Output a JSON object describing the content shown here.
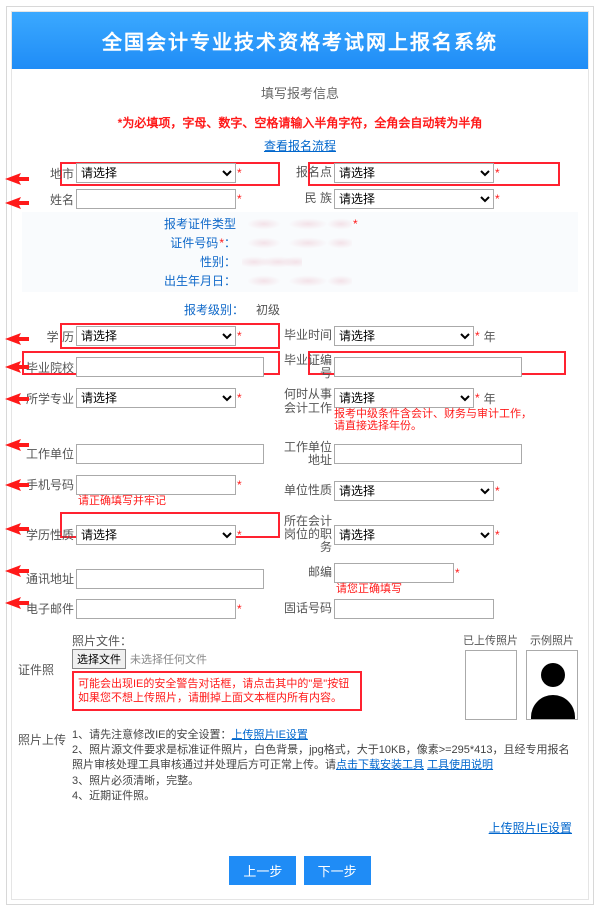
{
  "header": {
    "title": "全国会计专业技术资格考试网上报名系统"
  },
  "section_title": "填写报考信息",
  "required_note": "*为必填项，字母、数字、空格请输入半角字符，全角会自动转为半角",
  "flow_link": "查看报名流程",
  "placeholders": {
    "select": "请选择"
  },
  "fields": {
    "city_label": "地市",
    "point_label": "报名点",
    "name_label": "姓名",
    "nation_label": "民 族",
    "cert_type_label": "报考证件类型",
    "cert_no_label": "证件号码",
    "gender_label": "性别：",
    "birth_label": "出生年月日：",
    "level_label": "报考级别：",
    "level_value": "初级",
    "edu_label": "学 历",
    "gradtime_label": "毕业时间",
    "gradschool_label": "毕业院校",
    "gradcert_label": "毕业证编号",
    "major_label": "所学专业",
    "work_when_label": "何时从事会计工作",
    "work_when_hint": "报考中级条件含会计、财务与审计工作，请直接选择年份。",
    "work_unit_label": "工作单位",
    "work_addr_label": "工作单位地址",
    "phone_label": "手机号码",
    "phone_hint": "请正确填写并牢记",
    "unit_nature_label": "单位性质",
    "edu_nature_label": "学历性质",
    "acct_post_label": "所在会计岗位的职务",
    "addr_label": "通讯地址",
    "zip_label": "邮编",
    "zip_hint": "请您正确填写",
    "email_label": "电子邮件",
    "tel_label": "固话号码",
    "year_suffix": "年"
  },
  "photo": {
    "file_label": "照片文件：",
    "choose_btn": "选择文件",
    "no_file": "未选择任何文件",
    "warn1": "可能会出现IE的安全警告对话框，请点击其中的\"是\"按钮",
    "warn2": "如果您不想上传照片，请删掉上面文本框内所有内容。",
    "cert_label": "证件照",
    "upl_col1": "已上传照片",
    "upl_col2": "示例照片",
    "inst_label": "照片上传",
    "inst1": "1、请先注意修改IE的安全设置：",
    "inst1_link": "上传照片IE设置",
    "inst2": "2、照片源文件要求是标准证件照片，白色背景，jpg格式，大于10KB，像素>=295*413，且经专用报名照片审核处理工具审核通过并处理后方可正常上传。请",
    "inst2_link1": "点击下载安装工具",
    "inst2_link2": "工具使用说明",
    "inst3": "3、照片必须清晰，完整。",
    "inst4": "4、近期证件照。",
    "ie_link": "上传照片IE设置"
  },
  "nav": {
    "prev": "上一步",
    "next": "下一步"
  }
}
